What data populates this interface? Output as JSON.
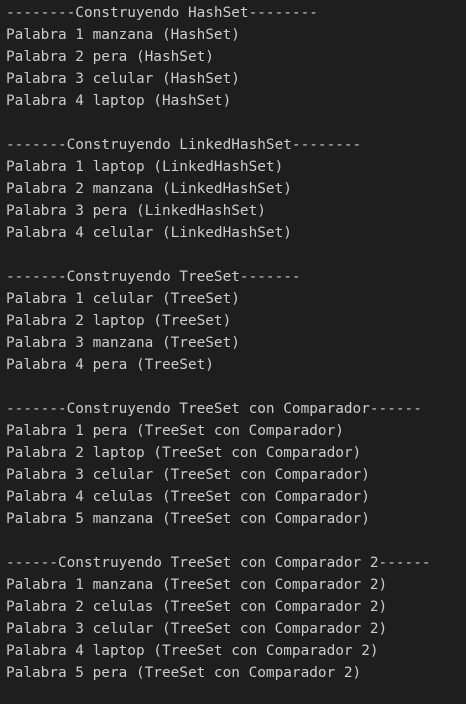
{
  "terminal": {
    "lines": [
      "--------Construyendo HashSet--------",
      "Palabra 1 manzana (HashSet)",
      "Palabra 2 pera (HashSet)",
      "Palabra 3 celular (HashSet)",
      "Palabra 4 laptop (HashSet)",
      "",
      "-------Construyendo LinkedHashSet--------",
      "Palabra 1 laptop (LinkedHashSet)",
      "Palabra 2 manzana (LinkedHashSet)",
      "Palabra 3 pera (LinkedHashSet)",
      "Palabra 4 celular (LinkedHashSet)",
      "",
      "-------Construyendo TreeSet-------",
      "Palabra 1 celular (TreeSet)",
      "Palabra 2 laptop (TreeSet)",
      "Palabra 3 manzana (TreeSet)",
      "Palabra 4 pera (TreeSet)",
      "",
      "-------Construyendo TreeSet con Comparador------",
      "Palabra 1 pera (TreeSet con Comparador)",
      "Palabra 2 laptop (TreeSet con Comparador)",
      "Palabra 3 celular (TreeSet con Comparador)",
      "Palabra 4 celulas (TreeSet con Comparador)",
      "Palabra 5 manzana (TreeSet con Comparador)",
      "",
      "------Construyendo TreeSet con Comparador 2------",
      "Palabra 1 manzana (TreeSet con Comparador 2)",
      "Palabra 2 celulas (TreeSet con Comparador 2)",
      "Palabra 3 celular (TreeSet con Comparador 2)",
      "Palabra 4 laptop (TreeSet con Comparador 2)",
      "Palabra 5 pera (TreeSet con Comparador 2)"
    ]
  }
}
